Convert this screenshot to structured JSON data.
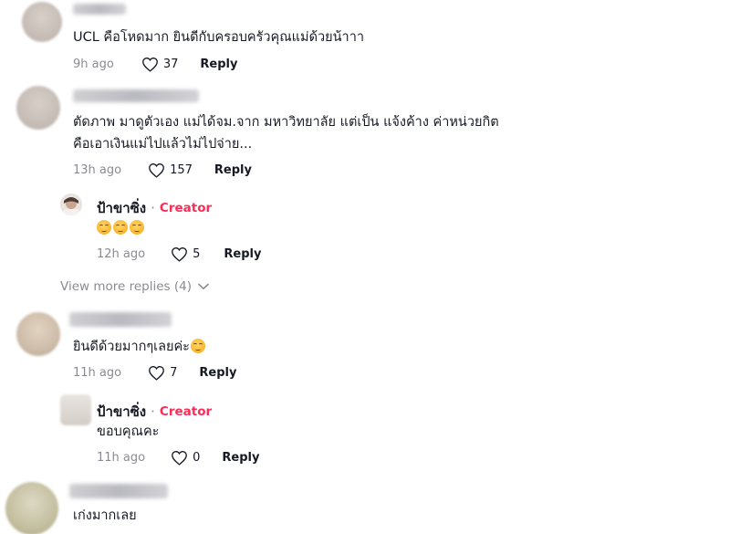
{
  "comments": [
    {
      "text": "UCL คือโหดมาก ยินดีกับครอบครัวคุณแม่ด้วยน้าาา",
      "time": "9h ago",
      "likes": "37",
      "reply": "Reply"
    },
    {
      "text_line1": "ตัดภาพ มาดูตัวเอง แม่ได้จม.จาก มหาวิทยาลัย แต่เป็น แจ้งค้าง ค่าหน่วยกิต",
      "text_line2": "คือเอาเงินแม่ไปแล้วไม่ไปจ่าย...",
      "time": "13h ago",
      "likes": "157",
      "reply": "Reply"
    },
    {
      "text": "ยินดีด้วยมากๆเลยค่ะ",
      "time": "11h ago",
      "likes": "7",
      "reply": "Reply"
    },
    {
      "text": "เก่งมากเลย"
    }
  ],
  "creator_replies": [
    {
      "name": "ป้าขาซิ่ง",
      "separator": "·",
      "tag": "Creator",
      "time": "12h ago",
      "likes": "5",
      "reply": "Reply"
    },
    {
      "name": "ป้าขาซิ่ง",
      "separator": "·",
      "tag": "Creator",
      "text": "ขอบคุณคะ",
      "time": "11h ago",
      "likes": "0",
      "reply": "Reply"
    }
  ],
  "view_more": "View more replies (4)",
  "colors": {
    "creator_tag": "#fe2c55",
    "meta_gray": "#8a8b91",
    "text": "#161823"
  }
}
